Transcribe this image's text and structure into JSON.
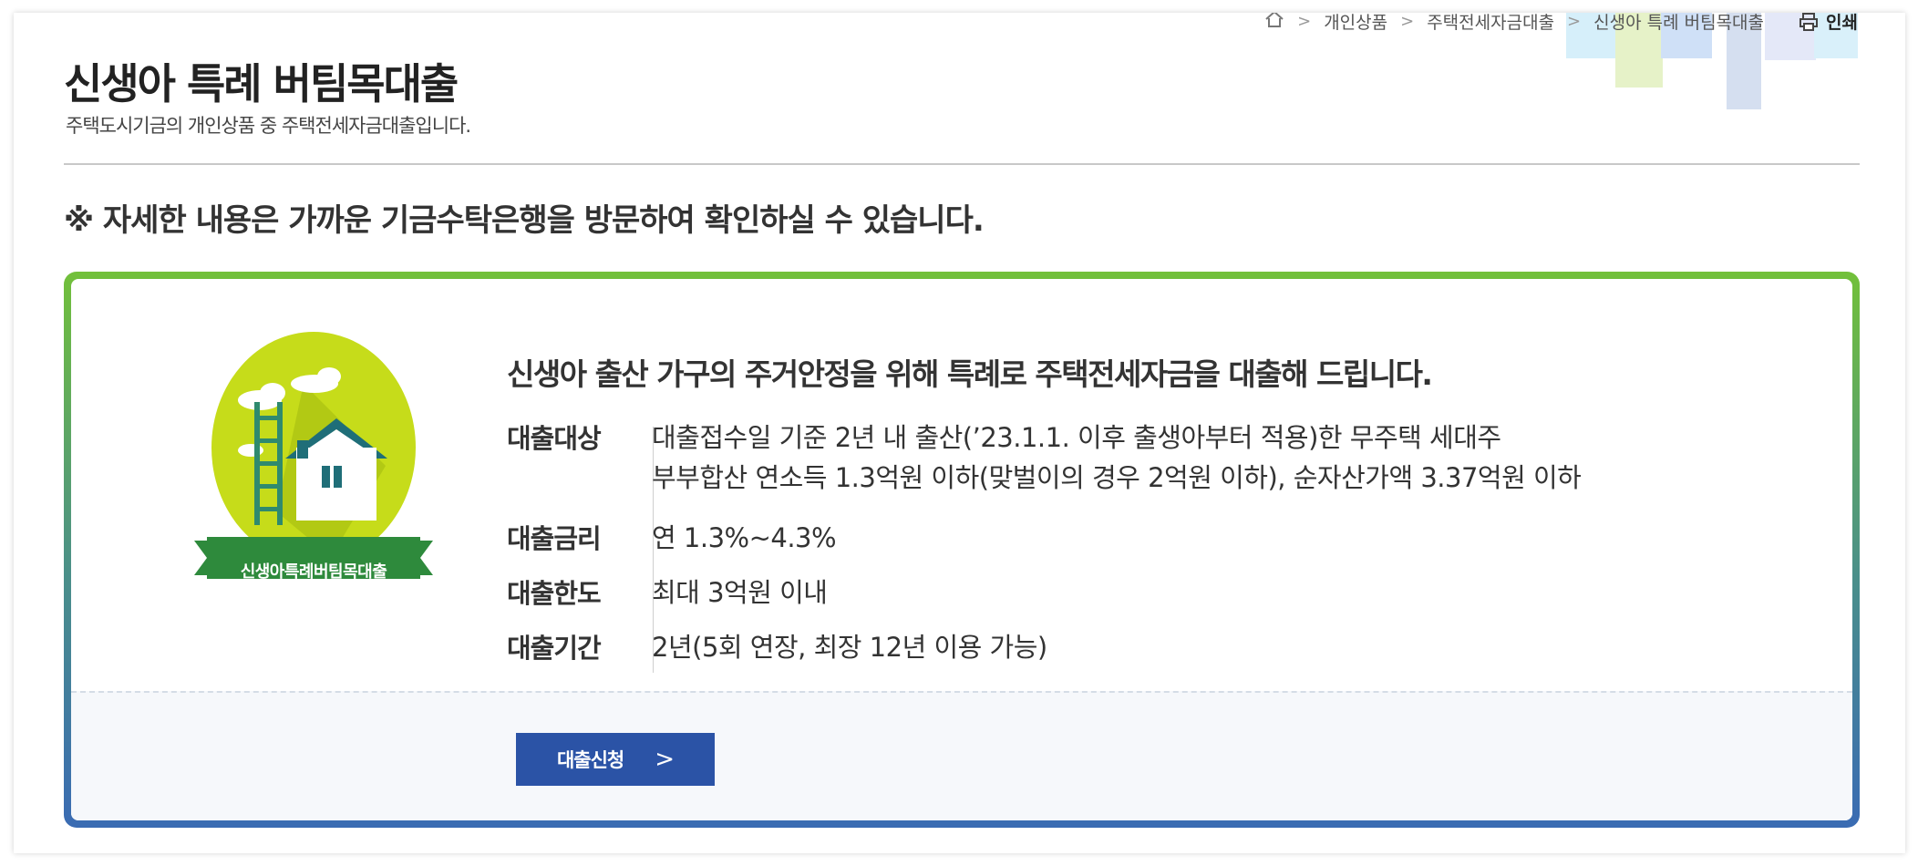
{
  "breadcrumb": {
    "items": [
      "개인상품",
      "주택전세자금대출",
      "신생아 특례 버팀목대출"
    ],
    "print_label": "인쇄"
  },
  "page": {
    "title": "신생아 특례 버팀목대출",
    "subtitle": "주택도시기금의 개인상품 중 주택전세자금대출입니다.",
    "notice": "※ 자세한 내용은 가까운 기금수탁은행을 방문하여 확인하실 수 있습니다."
  },
  "product": {
    "emblem_label": "신생아특례버팀목대출",
    "headline": "신생아 출산 가구의 주거안정을 위해 특례로 주택전세자금을 대출해 드립니다.",
    "details": [
      {
        "label": "대출대상",
        "lines": [
          "대출접수일 기준 2년 내 출산(’23.1.1. 이후 출생아부터 적용)한 무주택 세대주",
          "부부합산 연소득 1.3억원 이하(맞벌이의 경우 2억원 이하), 순자산가액 3.37억원 이하"
        ]
      },
      {
        "label": "대출금리",
        "lines": [
          "연 1.3%~4.3%"
        ]
      },
      {
        "label": "대출한도",
        "lines": [
          "최대 3억원 이내"
        ]
      },
      {
        "label": "대출기간",
        "lines": [
          "2년(5회 연장, 최장 12년 이용 가능)"
        ]
      }
    ],
    "apply_label": "대출신청"
  },
  "colors": {
    "frame_top": "#72c03a",
    "frame_bottom": "#3a6bb3",
    "button": "#2b53a6",
    "emblem_green": "#c6dc1a",
    "ribbon_green": "#2e8a3c"
  }
}
